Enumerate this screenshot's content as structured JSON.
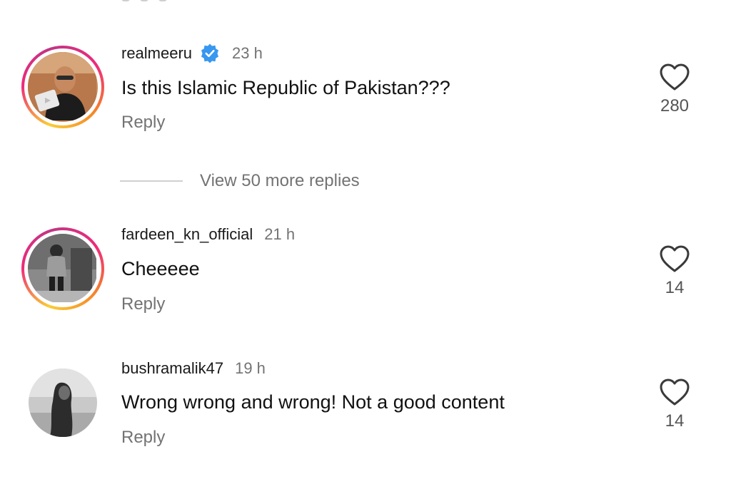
{
  "comments": [
    {
      "username": "realmeeru",
      "verified": true,
      "time": "23 h",
      "text": "Is this Islamic Republic of Pakistan???",
      "reply_label": "Reply",
      "likes": "280",
      "avatar_story_ring": true
    },
    {
      "username": "fardeen_kn_official",
      "verified": false,
      "time": "21 h",
      "text": "Cheeeee",
      "reply_label": "Reply",
      "likes": "14",
      "avatar_story_ring": true
    },
    {
      "username": "bushramalik47",
      "verified": false,
      "time": "19 h",
      "text": "Wrong wrong and wrong! Not a good content",
      "reply_label": "Reply",
      "likes": "14",
      "avatar_story_ring": false
    }
  ],
  "view_more_replies": "View 50 more replies",
  "icons": {
    "like": "heart-outline-icon",
    "verified": "verified-badge-icon"
  },
  "colors": {
    "verified_blue": "#3897f0",
    "secondary_text": "#737373",
    "story_ring_start": "#f9ce34",
    "story_ring_mid": "#ee2a7b",
    "story_ring_end": "#c13584"
  }
}
